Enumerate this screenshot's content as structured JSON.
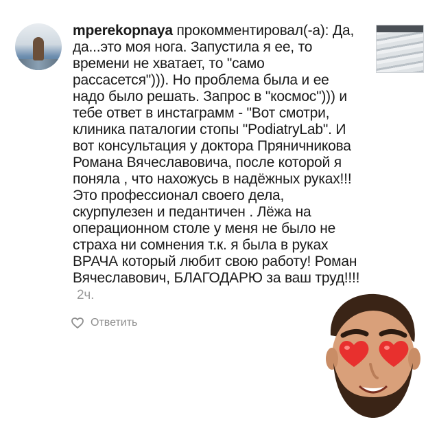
{
  "comment": {
    "username": "mperekopnaya",
    "action": "прокомментировал(-а):",
    "text": "Да, да...это моя нога. Запустила я ее, то времени не хватает, то \"само рассасется\"))). Но проблема была и ее надо было решать. Запрос в \"космос\"))) и тебе ответ в инстаграмм - \"Вот смотри, клиника паталогии стопы \"PodiatryLab\". И вот консультация у доктора Пряничникова Романа Вячеславовича, после которой я поняла , что нахожусь в надёжных руках!!! Это профессионал своего дела, скурпулезен и педантичен . Лёжа на операционном столе у меня не было не страха ни сомнения т.к. я была в руках ВРАЧА который любит свою работу! Роман Вячеславович, БЛАГОДАРЮ за ваш труд!!!!",
    "time": "2ч."
  },
  "actions": {
    "like_icon": "heart-outline-icon",
    "reply_label": "Ответить"
  },
  "colors": {
    "text": "#1a1a1a",
    "muted": "#8e8e8e",
    "time": "#9a9a9a"
  }
}
